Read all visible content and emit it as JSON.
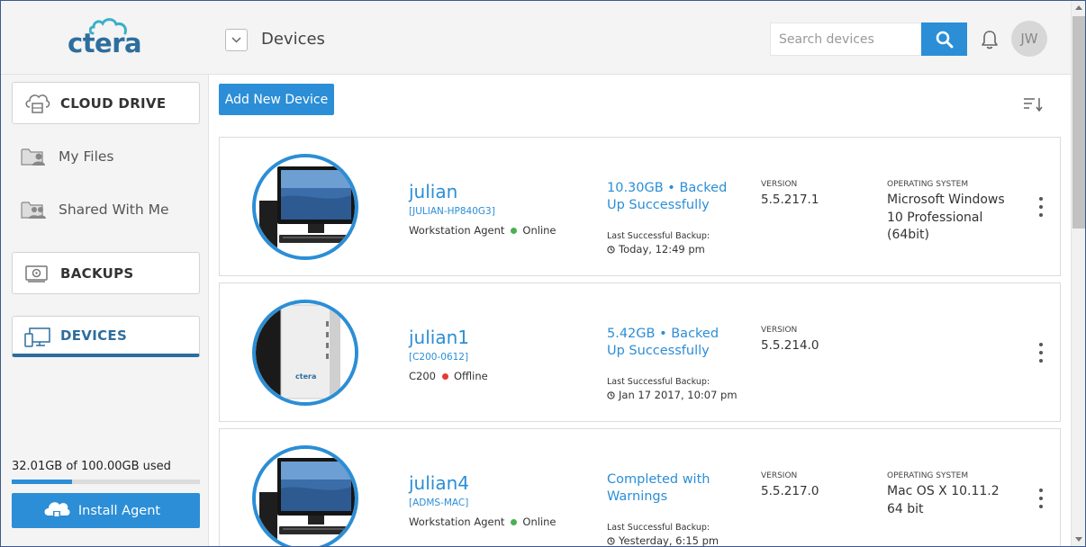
{
  "header": {
    "logo_text": "ctera",
    "page_title": "Devices",
    "search_placeholder": "Search devices",
    "avatar_initials": "JW"
  },
  "sidebar": {
    "cloud_drive": "CLOUD DRIVE",
    "my_files": "My Files",
    "shared_with_me": "Shared With Me",
    "backups": "BACKUPS",
    "devices": "DEVICES",
    "storage_text": "32.01GB of 100.00GB used",
    "storage_used_fraction": 0.3201,
    "install_agent": "Install Agent"
  },
  "main": {
    "add_button": "Add New Device",
    "devices": [
      {
        "name": "julian",
        "host": "[JULIAN-HP840G3]",
        "type": "Workstation Agent",
        "status": "Online",
        "status_color": "#4caf50",
        "backup_status": "10.30GB • Backed Up Successfully",
        "last_backup_label": "Last Successful Backup:",
        "last_backup_time": "Today, 12:49 pm",
        "version_label": "VERSION",
        "version": "5.5.217.1",
        "os_label": "OPERATING SYSTEM",
        "os": "Microsoft Windows 10 Professional (64bit)",
        "image": "desktop-monitor"
      },
      {
        "name": "julian1",
        "host": "[C200-0612]",
        "type": "C200",
        "status": "Offline",
        "status_color": "#e53935",
        "backup_status": "5.42GB • Backed Up Successfully",
        "last_backup_label": "Last Successful Backup:",
        "last_backup_time": "Jan 17 2017, 10:07 pm",
        "version_label": "VERSION",
        "version": "5.5.214.0",
        "os_label": "",
        "os": "",
        "image": "c200-appliance"
      },
      {
        "name": "julian4",
        "host": "[ADMS-MAC]",
        "type": "Workstation Agent",
        "status": "Online",
        "status_color": "#4caf50",
        "backup_status": "Completed with Warnings",
        "last_backup_label": "Last Successful Backup:",
        "last_backup_time": "Yesterday, 6:15 pm",
        "version_label": "VERSION",
        "version": "5.5.217.0",
        "os_label": "OPERATING SYSTEM",
        "os": "Mac OS X 10.11.2 64 bit",
        "image": "desktop-monitor"
      }
    ]
  },
  "colors": {
    "accent": "#2b8ed6",
    "brand": "#2d6e9e"
  }
}
